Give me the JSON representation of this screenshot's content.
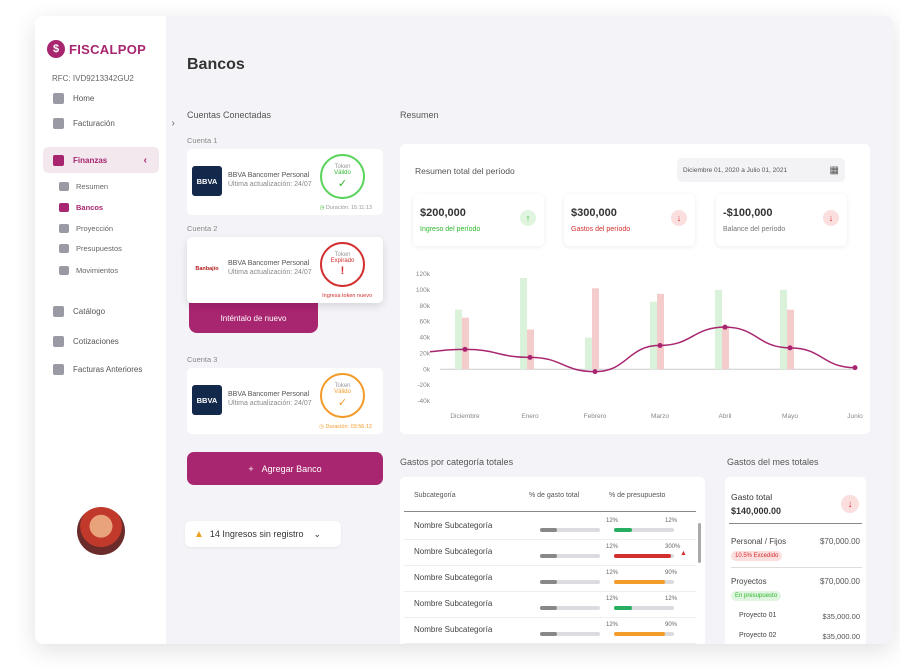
{
  "brand": {
    "name": "FISCALPOP",
    "rfc": "RFC: IVD9213342GU2"
  },
  "nav": {
    "items": [
      {
        "label": "Home"
      },
      {
        "label": "Facturación"
      },
      {
        "label": "Finanzas"
      },
      {
        "label": "Catálogo"
      },
      {
        "label": "Cotizaciones"
      },
      {
        "label": "Facturas Anteriores"
      }
    ],
    "sub": [
      {
        "label": "Resumen"
      },
      {
        "label": "Bancos"
      },
      {
        "label": "Proyección"
      },
      {
        "label": "Presupuestos"
      },
      {
        "label": "Movimientos"
      }
    ]
  },
  "page": {
    "title": "Bancos",
    "connected": "Cuentas Conectadas",
    "summary": "Resumen"
  },
  "accounts": [
    {
      "label": "Cuenta 1",
      "logo": "BBVA",
      "name": "BBVA Bancomer Personal",
      "updated": "Última actualización: 24/07",
      "token_label": "Token",
      "token_state": "Válido",
      "token_symbol": "✓",
      "duration": "Duración: 15:11:13",
      "color": "#5cd35c"
    },
    {
      "label": "Cuenta 2",
      "logo": "Banbajío",
      "name": "BBVA Bancomer Personal",
      "updated": "Última actualización: 24/07",
      "token_label": "Token",
      "token_state": "Expirado",
      "token_symbol": "!",
      "note": "Ingresa token nuevo",
      "color": "#d32f2f"
    },
    {
      "label": "Cuenta 3",
      "logo": "BBVA",
      "name": "BBVA Bancomer Personal",
      "updated": "Última actualización: 24/07",
      "token_label": "Token",
      "token_state": "Válido",
      "token_symbol": "✓",
      "duration": "Duración: 03:56:12",
      "color": "#f39c2a"
    }
  ],
  "retry": "Inténtalo de nuevo",
  "add_bank": "Agregar Banco",
  "unregistered": "14 Ingresos sin registro",
  "summary": {
    "title": "Resumen total del período",
    "date_from": "Diciembre 01, 2020",
    "date_sep": "a",
    "date_to": "Julio 01, 2021",
    "stats": [
      {
        "value": "$200,000",
        "label": "Ingreso del período",
        "color": "#2eb82e",
        "arrow": "↑"
      },
      {
        "value": "$300,000",
        "label": "Gastos del período",
        "color": "#d32f2f",
        "arrow": "↓"
      },
      {
        "value": "-$100,000",
        "label": "Balance del período",
        "color": "#777777",
        "arrow": "↓"
      }
    ]
  },
  "chart_data": {
    "type": "bar",
    "categories": [
      "Diciembre",
      "Enero",
      "Febrero",
      "Marzo",
      "Abril",
      "Mayo",
      "Junio"
    ],
    "ylim": [
      -40,
      120
    ],
    "y_ticks": [
      "120k",
      "100k",
      "80k",
      "60k",
      "40k",
      "20k",
      "0k",
      "-20k",
      "-40k"
    ],
    "series": [
      {
        "values": [
          75,
          115,
          40,
          85,
          100,
          100,
          0
        ],
        "color": "#d9f2d9"
      },
      {
        "values": [
          65,
          50,
          102,
          95,
          55,
          75,
          0
        ],
        "color": "#f5cccc"
      },
      {
        "values": [
          25,
          15,
          -3,
          30,
          53,
          27,
          2
        ],
        "color": "#a8256f",
        "kind": "line"
      }
    ]
  },
  "cat_table": {
    "title": "Gastos por categoría totales",
    "headers": [
      "Subcategoría",
      "% de gasto total",
      "% de presupuesto"
    ],
    "rows": [
      {
        "name": "Nombre Subcategoría",
        "p1": "12%",
        "f1": 0.28,
        "p2": "12%",
        "f2": 0.3,
        "c2": "#27ae60",
        "warn": ""
      },
      {
        "name": "Nombre Subcategoría",
        "p1": "12%",
        "f1": 0.28,
        "p2": "300%",
        "f2": 0.95,
        "c2": "#d32f2f",
        "warn": "▲"
      },
      {
        "name": "Nombre Subcategoría",
        "p1": "12%",
        "f1": 0.28,
        "p2": "90%",
        "f2": 0.85,
        "c2": "#f39c2a",
        "warn": ""
      },
      {
        "name": "Nombre Subcategoría",
        "p1": "12%",
        "f1": 0.28,
        "p2": "12%",
        "f2": 0.3,
        "c2": "#27ae60",
        "warn": ""
      },
      {
        "name": "Nombre Subcategoría",
        "p1": "12%",
        "f1": 0.28,
        "p2": "90%",
        "f2": 0.85,
        "c2": "#f39c2a",
        "warn": ""
      }
    ]
  },
  "month": {
    "title": "Gastos del mes totales",
    "total_label": "Gasto total",
    "total": "$140,000.00",
    "items": [
      {
        "name": "Personal / Fijos",
        "amount": "$70,000.00",
        "tag": "10.5% Excedido"
      },
      {
        "name": "Proyectos",
        "amount": "$70,000.00",
        "tag": "En presupuesto"
      },
      {
        "name": "Proyecto 01",
        "amount": "$35,000.00"
      },
      {
        "name": "Proyecto 02",
        "amount": "$35,000.00"
      }
    ]
  }
}
